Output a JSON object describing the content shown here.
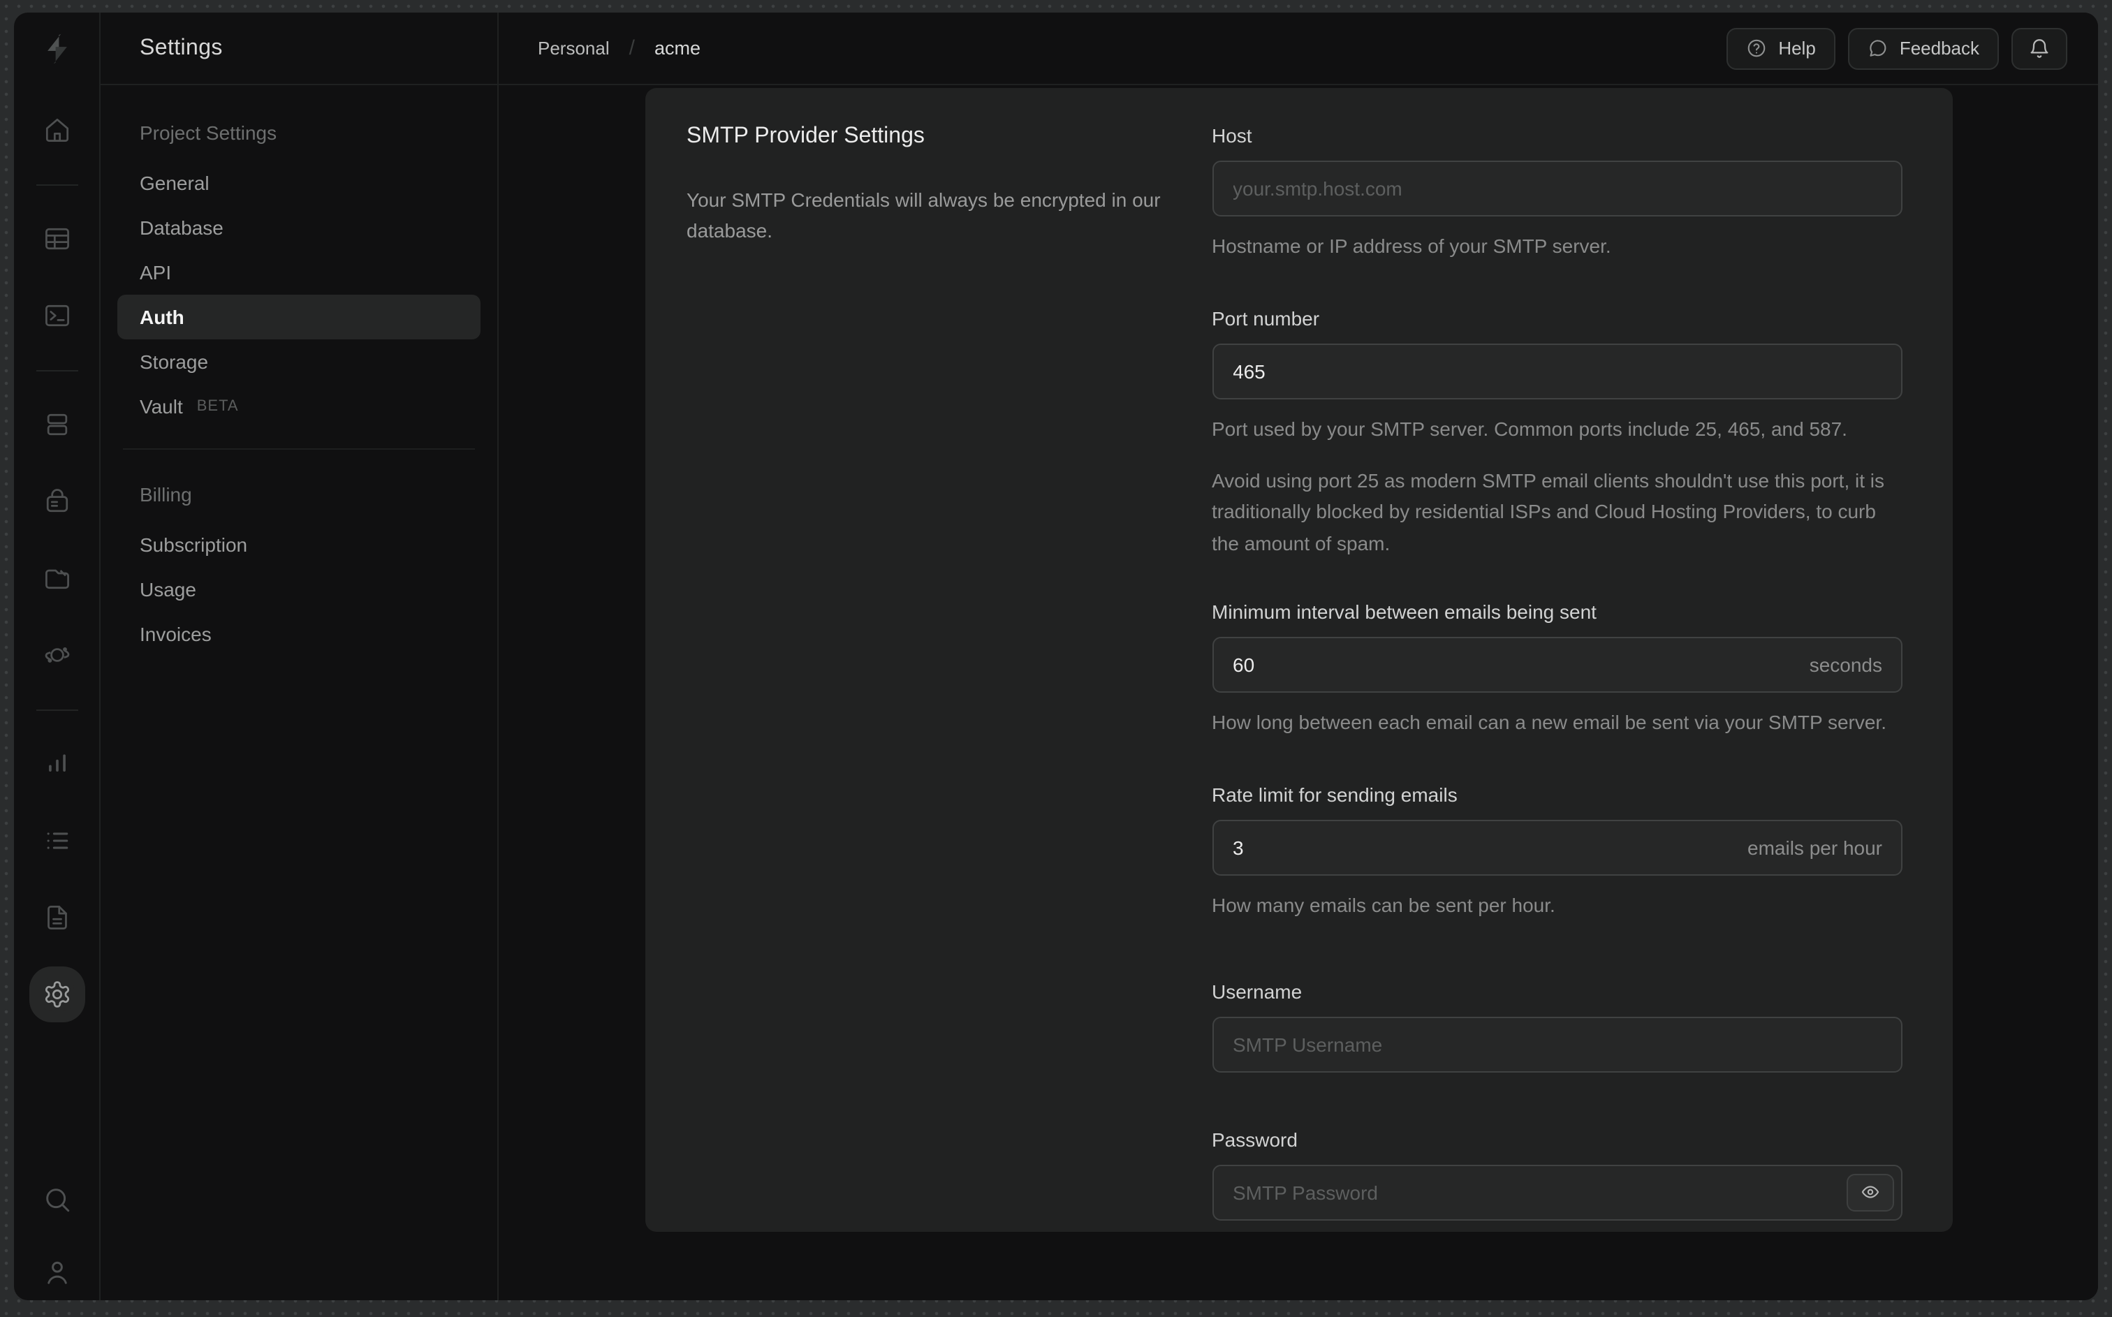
{
  "sidebar": {
    "title": "Settings",
    "sections": [
      {
        "header": "Project Settings",
        "items": [
          {
            "label": "General"
          },
          {
            "label": "Database"
          },
          {
            "label": "API"
          },
          {
            "label": "Auth",
            "active": true
          },
          {
            "label": "Storage"
          },
          {
            "label": "Vault",
            "badge": "BETA"
          }
        ]
      },
      {
        "header": "Billing",
        "items": [
          {
            "label": "Subscription"
          },
          {
            "label": "Usage"
          },
          {
            "label": "Invoices"
          }
        ]
      }
    ]
  },
  "rail": {
    "icons": [
      "supabase-logo",
      "home",
      "table-editor",
      "sql-editor",
      "database",
      "authentication",
      "storage",
      "edge-functions",
      "reports",
      "logs",
      "api-docs",
      "project-settings",
      "search",
      "account"
    ],
    "active": "project-settings"
  },
  "topbar": {
    "breadcrumb": {
      "org": "Personal",
      "separator": "/",
      "project": "acme"
    },
    "actions": {
      "help": "Help",
      "feedback": "Feedback",
      "notifications": "notifications-bell"
    }
  },
  "smtp": {
    "title": "SMTP Provider Settings",
    "description": "Your SMTP Credentials will always be encrypted in our database.",
    "fields": {
      "host": {
        "label": "Host",
        "placeholder": "your.smtp.host.com",
        "helper": "Hostname or IP address of your SMTP server."
      },
      "port": {
        "label": "Port number",
        "value": "465",
        "helper_1": "Port used by your SMTP server. Common ports include 25, 465, and 587.",
        "helper_2": "Avoid using port 25 as modern SMTP email clients shouldn't use this port, it is traditionally blocked by residential ISPs and Cloud Hosting Providers, to curb the amount of spam."
      },
      "interval": {
        "label": "Minimum interval between emails being sent",
        "value": "60",
        "suffix": "seconds",
        "helper": "How long between each email can a new email be sent via your SMTP server."
      },
      "rate": {
        "label": "Rate limit for sending emails",
        "value": "3",
        "suffix": "emails per hour",
        "helper": "How many emails can be sent per hour."
      },
      "username": {
        "label": "Username",
        "placeholder": "SMTP Username"
      },
      "password": {
        "label": "Password",
        "placeholder": "SMTP Password"
      }
    }
  },
  "colors": {
    "desktop": "#2a2c2d",
    "window_bg": "#101011",
    "panel_bg": "#212222",
    "input_bg": "#262727",
    "input_border": "#404242",
    "active_item_bg": "#252626",
    "text_primary": "#ececec",
    "text_muted": "#8a8b8b"
  }
}
